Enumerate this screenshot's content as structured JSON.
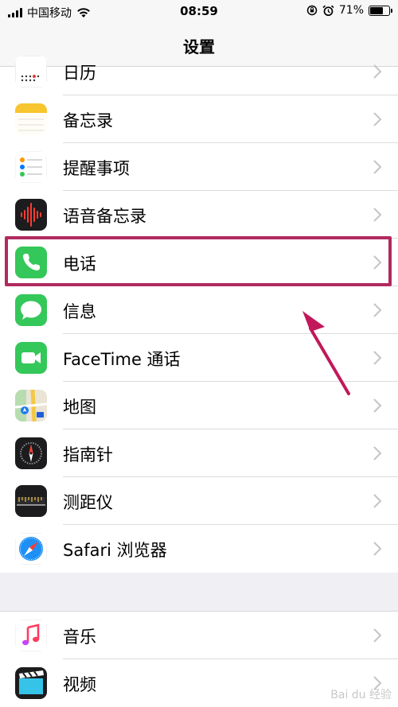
{
  "status_bar": {
    "carrier": "中国移动",
    "time": "08:59",
    "battery": "71%",
    "battery_level": 0.71
  },
  "nav": {
    "title": "设置"
  },
  "items": [
    {
      "label": "日历",
      "icon": "calendar-icon"
    },
    {
      "label": "备忘录",
      "icon": "notes-icon"
    },
    {
      "label": "提醒事项",
      "icon": "reminders-icon"
    },
    {
      "label": "语音备忘录",
      "icon": "voice-memos-icon"
    },
    {
      "label": "电话",
      "icon": "phone-icon",
      "highlighted": true
    },
    {
      "label": "信息",
      "icon": "messages-icon"
    },
    {
      "label": "FaceTime 通话",
      "icon": "facetime-icon"
    },
    {
      "label": "地图",
      "icon": "maps-icon"
    },
    {
      "label": "指南针",
      "icon": "compass-icon"
    },
    {
      "label": "测距仪",
      "icon": "measure-icon"
    },
    {
      "label": "Safari 浏览器",
      "icon": "safari-icon"
    }
  ],
  "items2": [
    {
      "label": "音乐",
      "icon": "music-icon"
    },
    {
      "label": "视频",
      "icon": "videos-icon"
    }
  ],
  "colors": {
    "highlight": "#b12a5f",
    "phone_green": "#34c759",
    "separator": "#dcdce0"
  }
}
